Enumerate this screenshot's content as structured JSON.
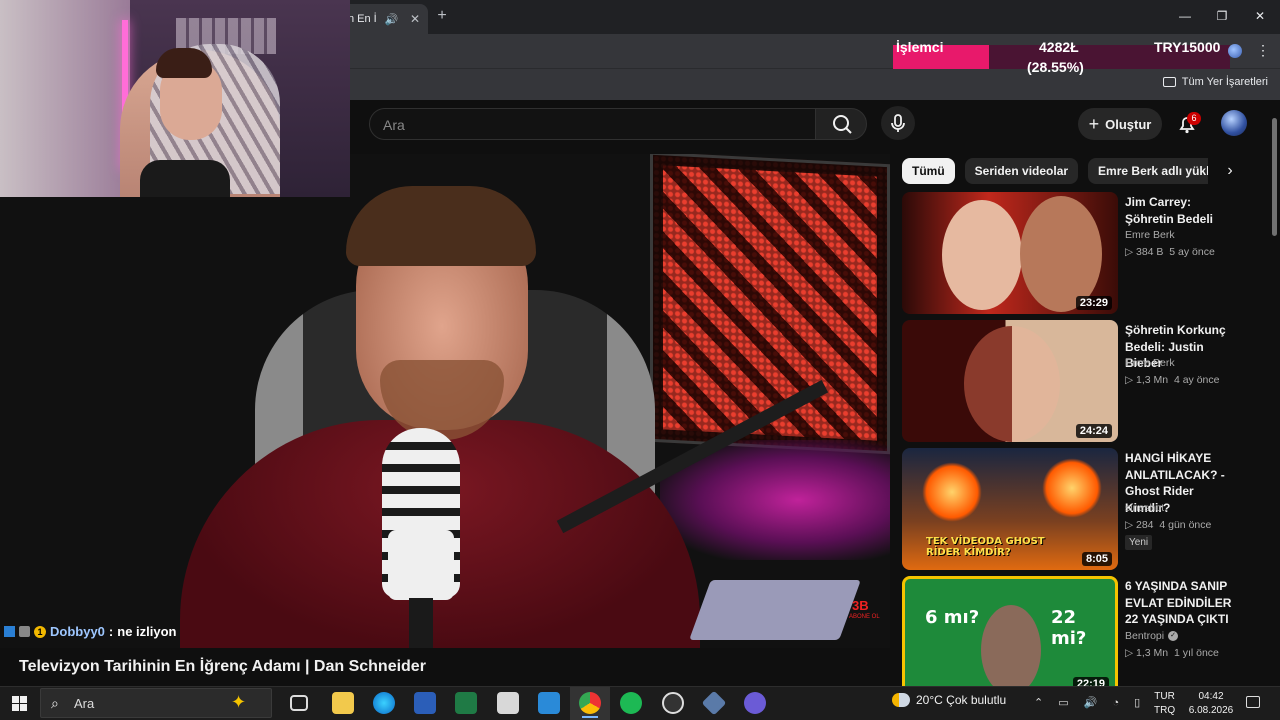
{
  "browser": {
    "tab_title": "n En İ",
    "bookmarks_all": "Tüm Yer İşaretleri"
  },
  "cpu_overlay": {
    "label": "İşlemci",
    "frequency": "4282Ł",
    "percent": "(28.55%)",
    "price": "TRY15000",
    "load_fraction": 0.2855,
    "colors": {
      "fill": "#e8196b",
      "rest": "#4a1433"
    }
  },
  "youtube": {
    "search_placeholder": "Ara",
    "create_label": "Oluştur",
    "notification_count": "6"
  },
  "chat": {
    "username": "Dobbyy0",
    "separator": " : ",
    "message": "ne izliyon"
  },
  "video": {
    "title": "Televizyon Tarihinin En İğrenç Adamı | Dan Schneider",
    "watermark_logo": "3B",
    "watermark_text": "ABONE OL"
  },
  "sidebar": {
    "chips": [
      "Tümü",
      "Seriden videolar",
      "Emre Berk adlı yükleyici"
    ],
    "recommendations": [
      {
        "title": "Jim Carrey: Şöhretin Bedeli",
        "channel": "Emre Berk",
        "views": "384 B",
        "age": "5 ay önce",
        "duration": "23:29",
        "verified": false,
        "is_new": false
      },
      {
        "title": "Şöhretin Korkunç Bedeli: Justin Bieber",
        "channel": "Emre Berk",
        "views": "1,3 Mn",
        "age": "4 ay önce",
        "duration": "24:24",
        "verified": false,
        "is_new": false
      },
      {
        "title": "HANGİ HİKAYE ANLATILACAK? - Ghost Rider Kimdir?",
        "channel": "sineshot.",
        "views": "284",
        "age": "4 gün önce",
        "duration": "8:05",
        "verified": false,
        "is_new": true,
        "new_label": "Yeni",
        "thumb_caption": "TEK VİDEODA GHOST RİDER KİMDİR?"
      },
      {
        "title": "6 YAŞINDA SANIP EVLAT EDİNDİLER 22 YAŞINDA ÇIKTI",
        "channel": "Bentropi",
        "views": "1,3 Mn",
        "age": "1 yıl önce",
        "duration": "22:19",
        "verified": true,
        "is_new": false,
        "thumb_left": "6 mı?",
        "thumb_right": "22 mi?"
      }
    ]
  },
  "taskbar": {
    "search_label": "Ara",
    "weather": "20°C  Çok bulutlu",
    "lang_top": "TUR",
    "lang_bottom": "TRQ",
    "time": "04:42",
    "date": "6.08.2026",
    "weather_badge": "1"
  }
}
